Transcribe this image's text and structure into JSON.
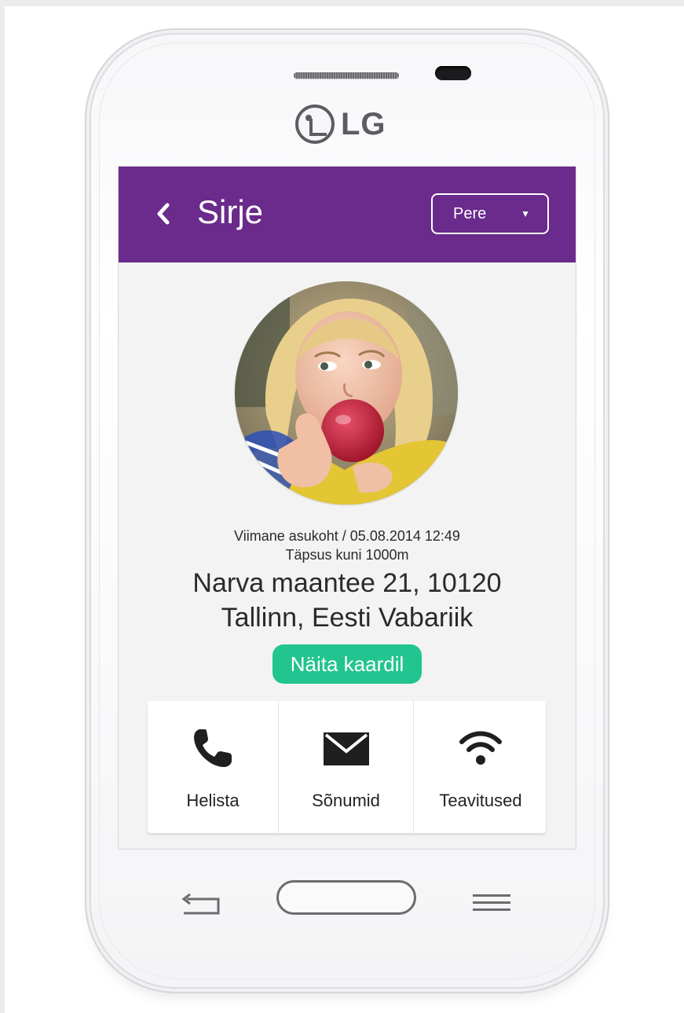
{
  "device": {
    "brand": "LG",
    "hardware_keys": [
      "back-key",
      "home-key",
      "menu-key"
    ]
  },
  "header": {
    "title": "Sirje",
    "back_icon": "chevron-left-icon",
    "group_select": {
      "value": "Pere",
      "icon": "triangle-down-icon"
    }
  },
  "profile": {
    "avatar": "child-photo",
    "last_location": "Viimane asukoht / 05.08.2014  12:49",
    "accuracy": "Täpsus kuni 1000m",
    "address_line1": "Narva maantee 21,  10120",
    "address_line2": "Tallinn,  Eesti Vabariik"
  },
  "map_button": {
    "label": "Näita kaardil",
    "color": "#22c48f"
  },
  "actions": [
    {
      "label": "Helista",
      "icon": "phone-icon"
    },
    {
      "label": "Sõnumid",
      "icon": "envelope-icon"
    },
    {
      "label": "Teavitused",
      "icon": "wifi-icon"
    }
  ],
  "colors": {
    "appbar": "#6a2b8c",
    "accent": "#22c48f",
    "screen_bg": "#f3f3f3"
  }
}
